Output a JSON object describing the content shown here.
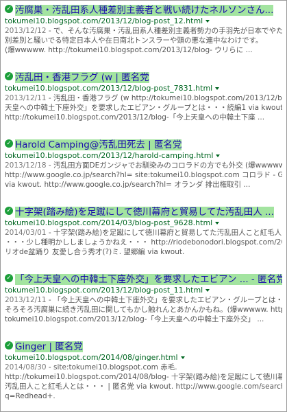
{
  "results": [
    {
      "title": "汚腐巣・汚乱田系人種差別主義者と戦い続けたネルソンさん...",
      "url": "tokumei10.blogspot.com/2013/12/blog-post_12.html",
      "date": "2013/12/12",
      "snippet": [
        "- で、そんな汚腐巣・汚乱田系人種差別主義者勢力の手羽先が日本でやたら差",
        "別差別と騒いでる特定日本人や在日南北トンスラーや頭の悪な連中なわけです。",
        "(爆wwwww. http://tokumei10.blogspot.com/2013/12/blog- ウリらに ..."
      ]
    },
    {
      "title": "汚乱田・香港フラグ (w | 匿名党",
      "url": "tokumei10.blogspot.com/2013/12/blog-post_7831.html",
      "date": "2013/12/11",
      "snippet": [
        "- 汚乱田・香港フラグ (w http://tokumei10.blogspot.com/2013/12/blog-「今上",
        "天皇への中韓土下座外交」を要求したエビアン・グループとは・・・続編1 via kwout.",
        "http://tokumei10.blogspot.com/2013/12/blog-「今上天皇への中韓土下座 ..."
      ]
    },
    {
      "title": "Harold Camping@汚乱田死去 | 匿名党",
      "url": "tokumei10.blogspot.com/2013/12/harold-camping.html",
      "date": "2013/12/18",
      "snippet": [
        "- 汚乱田方面DEガンジャでお馴染みのコロラドの方でも外交 (爆wwwww.",
        "http://www.google.co.jp/search?hl= site:tokumei10.blogspot.com コロラド - Google 検索",
        "via kwout. http://www.google.co.jp/search?hl= オランダ 排出権取引 ..."
      ]
    },
    {
      "title": "十字架(踏み絵)を足蹴にして徳川幕府と貿易してた汚乱田人 ...",
      "url": "tokumei10.blogspot.com/2014/03/blog-post_9628.html",
      "date": "2014/03/01",
      "snippet": [
        "- 十字架(踏み絵)を足蹴にして徳川幕府と貿易してた汚乱田人こと紅毛人とは",
        "・・・少し種明かししましょうかねえ・・・ http://riodebonodori.blogspot.com/2014/03/blog-",
        "リオde盆踊り 友愛し合う秀才(?)ミ. 望郷編 via kwout."
      ]
    },
    {
      "title": "「今上天皇への中韓土下座外交」を要求したエビアン ... - 匿名党",
      "url": "tokumei10.blogspot.com/2013/12/blog-post_11.html",
      "date": "2013/12/11",
      "snippet": [
        "- 「今上天皇への中韓土下座外交」を要求したエビアン・グループとは・・・続編1.",
        "そろそろ汚腐巣に続き汚乱田に関してもかし触れんとあかんかもね。(爆wwwww. http://",
        "tokumei10.blogspot.com/2013/12/blog-「今上天皇への中韓土下座外交」 ..."
      ]
    },
    {
      "title": "Ginger | 匿名党",
      "url": "tokumei10.blogspot.com/2014/08/ginger.html",
      "date": "2014/08/30",
      "snippet": [
        "- site:tokumei10.blogspot.com 赤毛.",
        "http://tokumei10.blogspot.com/2014/08/blog- 十字架(踏み絵)を足蹴にして徳川幕府と貿易してた",
        "汚乱田人こと紅毛人とは・・・ | 匿名党 via kwout. http://www.google.com/search?",
        "q=Redhead+."
      ]
    }
  ]
}
